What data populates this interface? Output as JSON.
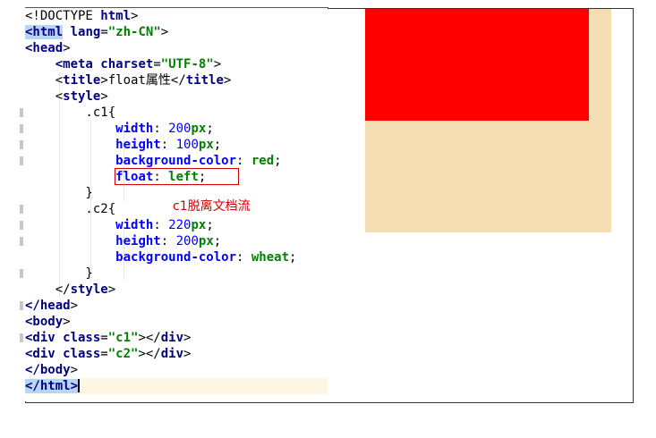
{
  "code_lines": [
    {
      "t": [
        [
          "",
          "<!DOCTYPE "
        ],
        [
          "tag",
          "html"
        ],
        [
          "",
          ">"
        ]
      ]
    },
    {
      "t": [
        [
          "sel tag",
          "<html"
        ],
        [
          "tag",
          " lang"
        ],
        [
          "",
          "="
        ],
        [
          "str",
          "\"zh-CN\""
        ],
        [
          "",
          ">"
        ]
      ]
    },
    {
      "t": [
        [
          "tag",
          "<head"
        ],
        [
          "",
          ">"
        ]
      ]
    },
    {
      "t": [
        [
          "",
          "    "
        ],
        [
          "tag",
          "<meta"
        ],
        [
          "tag",
          " charset"
        ],
        [
          "",
          "="
        ],
        [
          "str",
          "\"UTF-8\""
        ],
        [
          "",
          ">"
        ]
      ]
    },
    {
      "t": [
        [
          "",
          "    <"
        ],
        [
          "tag",
          "title"
        ],
        [
          "",
          ">float属性</"
        ],
        [
          "tag",
          "title"
        ],
        [
          "",
          ">"
        ]
      ]
    },
    {
      "t": [
        [
          "",
          "    <"
        ],
        [
          "tag",
          "style"
        ],
        [
          "",
          ">"
        ]
      ]
    },
    {
      "t": [
        [
          "",
          "        .c1{"
        ]
      ]
    },
    {
      "t": [
        [
          "",
          "            "
        ],
        [
          "prop",
          "width"
        ],
        [
          "",
          ": "
        ],
        [
          "num",
          "200"
        ],
        [
          "unit",
          "px"
        ],
        [
          "",
          ";"
        ]
      ]
    },
    {
      "t": [
        [
          "",
          "            "
        ],
        [
          "prop",
          "height"
        ],
        [
          "",
          ": "
        ],
        [
          "num",
          "100"
        ],
        [
          "unit",
          "px"
        ],
        [
          "",
          ";"
        ]
      ]
    },
    {
      "t": [
        [
          "",
          "            "
        ],
        [
          "prop",
          "background-color"
        ],
        [
          "",
          ": "
        ],
        [
          "val",
          "red"
        ],
        [
          "",
          ";"
        ]
      ]
    },
    {
      "t": [
        [
          "",
          "            "
        ],
        [
          "prop",
          "float"
        ],
        [
          "",
          ": "
        ],
        [
          "val",
          "left"
        ],
        [
          "",
          ";"
        ]
      ]
    },
    {
      "t": [
        [
          "",
          "        }"
        ]
      ]
    },
    {
      "t": [
        [
          "",
          "        .c2{"
        ]
      ]
    },
    {
      "t": [
        [
          "",
          "            "
        ],
        [
          "prop",
          "width"
        ],
        [
          "",
          ": "
        ],
        [
          "num",
          "220"
        ],
        [
          "unit",
          "px"
        ],
        [
          "",
          ";"
        ]
      ]
    },
    {
      "t": [
        [
          "",
          "            "
        ],
        [
          "prop",
          "height"
        ],
        [
          "",
          ": "
        ],
        [
          "num",
          "200"
        ],
        [
          "unit",
          "px"
        ],
        [
          "",
          ";"
        ]
      ]
    },
    {
      "t": [
        [
          "",
          "            "
        ],
        [
          "prop",
          "background-color"
        ],
        [
          "",
          ": "
        ],
        [
          "val",
          "wheat"
        ],
        [
          "",
          ";"
        ]
      ]
    },
    {
      "t": [
        [
          "",
          "        }"
        ]
      ]
    },
    {
      "t": [
        [
          "",
          "    </"
        ],
        [
          "tag",
          "style"
        ],
        [
          "",
          ">"
        ]
      ]
    },
    {
      "t": [
        [
          "tag",
          "</head"
        ],
        [
          "",
          ">"
        ]
      ]
    },
    {
      "t": [
        [
          "tag",
          "<body"
        ],
        [
          "",
          ">"
        ]
      ]
    },
    {
      "t": [
        [
          "tag",
          "<div"
        ],
        [
          "tag",
          " class"
        ],
        [
          "",
          "="
        ],
        [
          "str",
          "\"c1\""
        ],
        [
          "",
          "></"
        ],
        [
          "tag",
          "div"
        ],
        [
          "",
          ">"
        ]
      ]
    },
    {
      "t": [
        [
          "tag",
          "<div"
        ],
        [
          "tag",
          " class"
        ],
        [
          "",
          "="
        ],
        [
          "str",
          "\"c2\""
        ],
        [
          "",
          "></"
        ],
        [
          "tag",
          "div"
        ],
        [
          "",
          ">"
        ]
      ]
    },
    {
      "t": [
        [
          "tag",
          "</body"
        ],
        [
          "",
          ">"
        ]
      ]
    },
    {
      "t": [
        [
          "sel tag",
          "</html>"
        ]
      ],
      "active": true
    }
  ],
  "annotation": {
    "text": "c1脱离文档流"
  },
  "preview": {
    "c1_color": "#ff0000",
    "c2_color": "#f5deb3"
  }
}
